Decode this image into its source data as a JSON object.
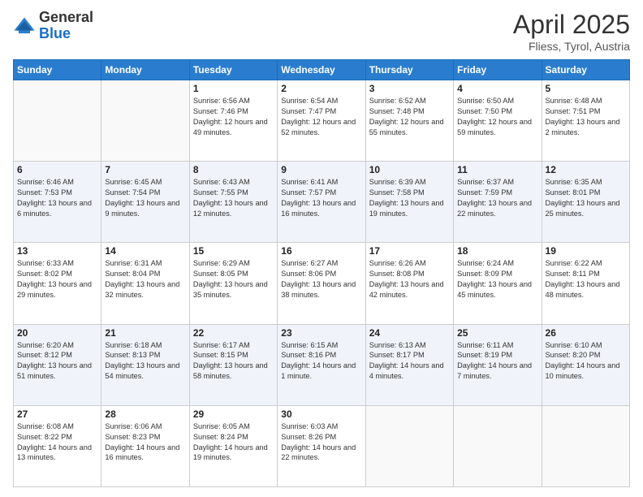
{
  "header": {
    "logo_general": "General",
    "logo_blue": "Blue",
    "month_year": "April 2025",
    "location": "Fliess, Tyrol, Austria"
  },
  "weekdays": [
    "Sunday",
    "Monday",
    "Tuesday",
    "Wednesday",
    "Thursday",
    "Friday",
    "Saturday"
  ],
  "weeks": [
    [
      {
        "day": "",
        "info": ""
      },
      {
        "day": "",
        "info": ""
      },
      {
        "day": "1",
        "info": "Sunrise: 6:56 AM\nSunset: 7:46 PM\nDaylight: 12 hours and 49 minutes."
      },
      {
        "day": "2",
        "info": "Sunrise: 6:54 AM\nSunset: 7:47 PM\nDaylight: 12 hours and 52 minutes."
      },
      {
        "day": "3",
        "info": "Sunrise: 6:52 AM\nSunset: 7:48 PM\nDaylight: 12 hours and 55 minutes."
      },
      {
        "day": "4",
        "info": "Sunrise: 6:50 AM\nSunset: 7:50 PM\nDaylight: 12 hours and 59 minutes."
      },
      {
        "day": "5",
        "info": "Sunrise: 6:48 AM\nSunset: 7:51 PM\nDaylight: 13 hours and 2 minutes."
      }
    ],
    [
      {
        "day": "6",
        "info": "Sunrise: 6:46 AM\nSunset: 7:53 PM\nDaylight: 13 hours and 6 minutes."
      },
      {
        "day": "7",
        "info": "Sunrise: 6:45 AM\nSunset: 7:54 PM\nDaylight: 13 hours and 9 minutes."
      },
      {
        "day": "8",
        "info": "Sunrise: 6:43 AM\nSunset: 7:55 PM\nDaylight: 13 hours and 12 minutes."
      },
      {
        "day": "9",
        "info": "Sunrise: 6:41 AM\nSunset: 7:57 PM\nDaylight: 13 hours and 16 minutes."
      },
      {
        "day": "10",
        "info": "Sunrise: 6:39 AM\nSunset: 7:58 PM\nDaylight: 13 hours and 19 minutes."
      },
      {
        "day": "11",
        "info": "Sunrise: 6:37 AM\nSunset: 7:59 PM\nDaylight: 13 hours and 22 minutes."
      },
      {
        "day": "12",
        "info": "Sunrise: 6:35 AM\nSunset: 8:01 PM\nDaylight: 13 hours and 25 minutes."
      }
    ],
    [
      {
        "day": "13",
        "info": "Sunrise: 6:33 AM\nSunset: 8:02 PM\nDaylight: 13 hours and 29 minutes."
      },
      {
        "day": "14",
        "info": "Sunrise: 6:31 AM\nSunset: 8:04 PM\nDaylight: 13 hours and 32 minutes."
      },
      {
        "day": "15",
        "info": "Sunrise: 6:29 AM\nSunset: 8:05 PM\nDaylight: 13 hours and 35 minutes."
      },
      {
        "day": "16",
        "info": "Sunrise: 6:27 AM\nSunset: 8:06 PM\nDaylight: 13 hours and 38 minutes."
      },
      {
        "day": "17",
        "info": "Sunrise: 6:26 AM\nSunset: 8:08 PM\nDaylight: 13 hours and 42 minutes."
      },
      {
        "day": "18",
        "info": "Sunrise: 6:24 AM\nSunset: 8:09 PM\nDaylight: 13 hours and 45 minutes."
      },
      {
        "day": "19",
        "info": "Sunrise: 6:22 AM\nSunset: 8:11 PM\nDaylight: 13 hours and 48 minutes."
      }
    ],
    [
      {
        "day": "20",
        "info": "Sunrise: 6:20 AM\nSunset: 8:12 PM\nDaylight: 13 hours and 51 minutes."
      },
      {
        "day": "21",
        "info": "Sunrise: 6:18 AM\nSunset: 8:13 PM\nDaylight: 13 hours and 54 minutes."
      },
      {
        "day": "22",
        "info": "Sunrise: 6:17 AM\nSunset: 8:15 PM\nDaylight: 13 hours and 58 minutes."
      },
      {
        "day": "23",
        "info": "Sunrise: 6:15 AM\nSunset: 8:16 PM\nDaylight: 14 hours and 1 minute."
      },
      {
        "day": "24",
        "info": "Sunrise: 6:13 AM\nSunset: 8:17 PM\nDaylight: 14 hours and 4 minutes."
      },
      {
        "day": "25",
        "info": "Sunrise: 6:11 AM\nSunset: 8:19 PM\nDaylight: 14 hours and 7 minutes."
      },
      {
        "day": "26",
        "info": "Sunrise: 6:10 AM\nSunset: 8:20 PM\nDaylight: 14 hours and 10 minutes."
      }
    ],
    [
      {
        "day": "27",
        "info": "Sunrise: 6:08 AM\nSunset: 8:22 PM\nDaylight: 14 hours and 13 minutes."
      },
      {
        "day": "28",
        "info": "Sunrise: 6:06 AM\nSunset: 8:23 PM\nDaylight: 14 hours and 16 minutes."
      },
      {
        "day": "29",
        "info": "Sunrise: 6:05 AM\nSunset: 8:24 PM\nDaylight: 14 hours and 19 minutes."
      },
      {
        "day": "30",
        "info": "Sunrise: 6:03 AM\nSunset: 8:26 PM\nDaylight: 14 hours and 22 minutes."
      },
      {
        "day": "",
        "info": ""
      },
      {
        "day": "",
        "info": ""
      },
      {
        "day": "",
        "info": ""
      }
    ]
  ]
}
